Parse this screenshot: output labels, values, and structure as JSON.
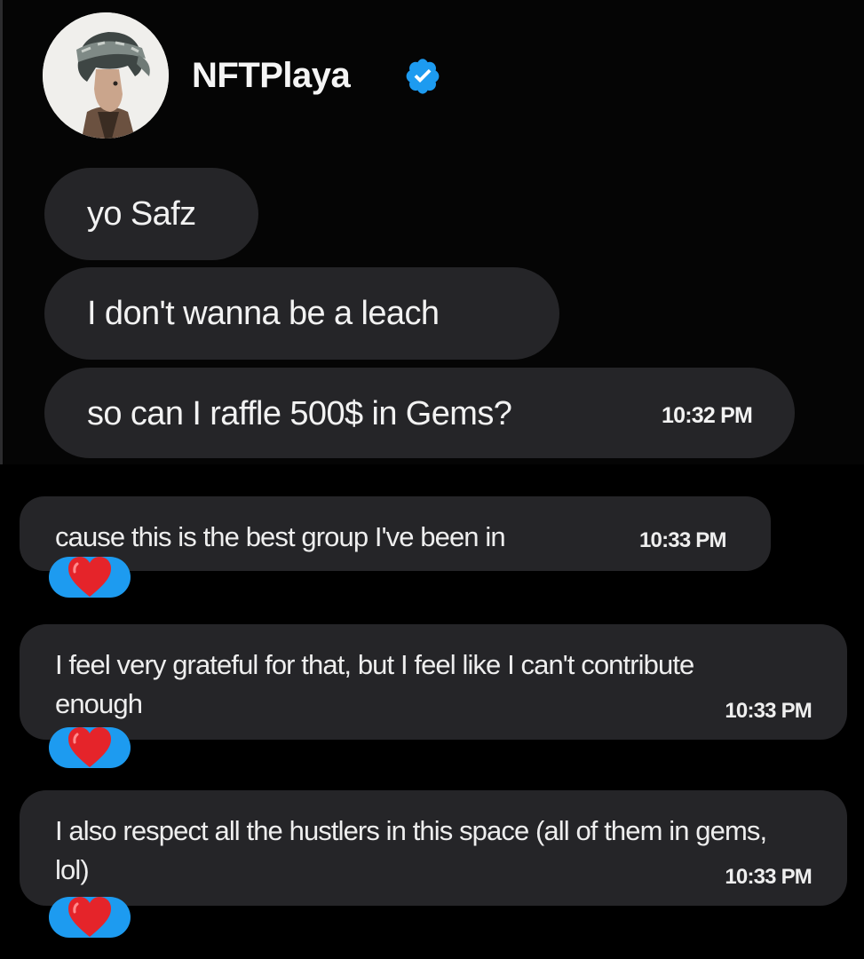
{
  "header": {
    "username": "NFTPlaya",
    "verified_badge_color": "#1d9bf0",
    "avatar_icon": "avatar-illustration"
  },
  "messages": [
    {
      "text": "yo Safz",
      "time": ""
    },
    {
      "text": "I don't wanna be a leach",
      "time": ""
    },
    {
      "text": "so can I raffle 500$ in Gems?",
      "time": "10:32 PM"
    },
    {
      "text": "cause this is the best group I've been in",
      "time": "10:33 PM",
      "reaction": "red-heart"
    },
    {
      "text": "I feel very grateful for that, but I feel like I can't contribute enough",
      "time": "10:33 PM",
      "reaction": "red-heart"
    },
    {
      "text": "I also respect all the hustlers in this space (all of them in gems, lol)",
      "time": "10:33 PM",
      "reaction": "red-heart"
    }
  ],
  "colors": {
    "background": "#000000",
    "bubble": "#252528",
    "reaction_pill": "#1d9bf0",
    "heart": "#e5242a"
  }
}
